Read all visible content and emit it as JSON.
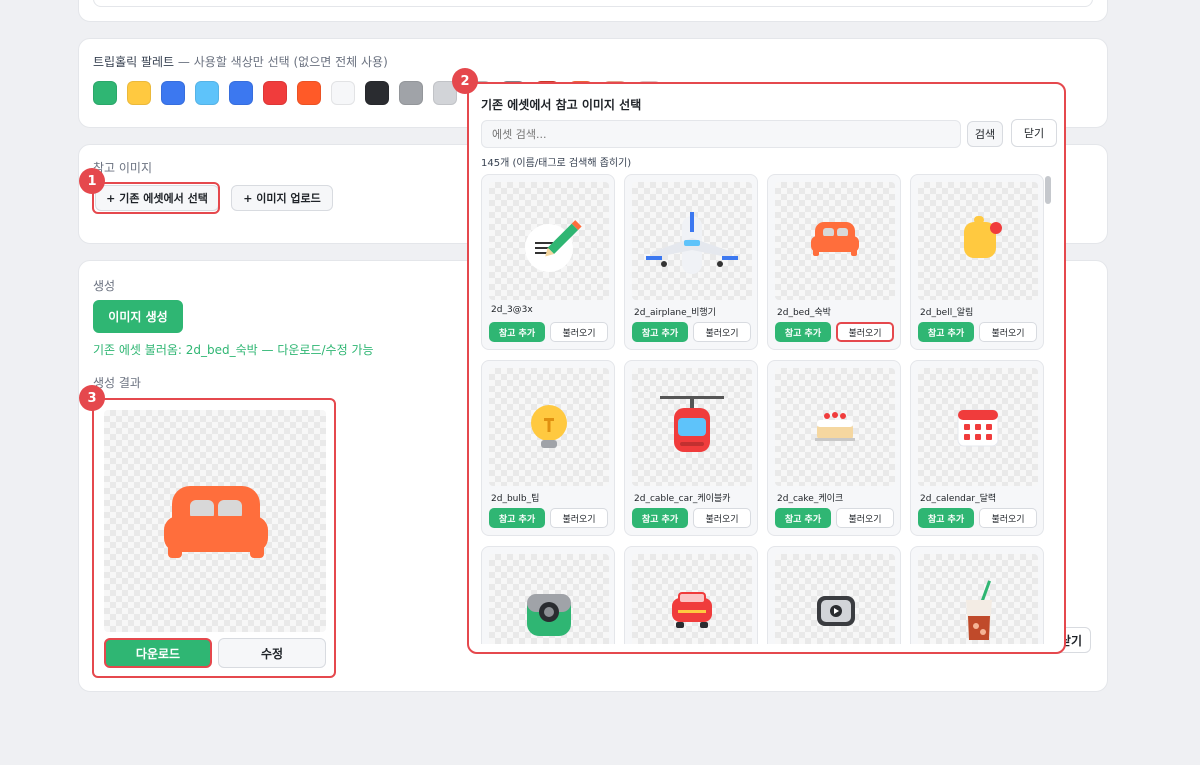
{
  "palette": {
    "title": "트립홀릭 팔레트",
    "hint": " — 사용할 색상만 선택 (없으면 전체 사용)",
    "colors": [
      "#2fb673",
      "#ffc940",
      "#3c78f0",
      "#5ec3fa",
      "#3c78f0",
      "#f03c3c",
      "#ff5a28",
      "#f6f7f9",
      "#2a2c30",
      "#a0a3a8",
      "#d2d4d8",
      "#c8c8c8",
      "#8c8f94",
      "#dc3c2a",
      "#ff6e3c",
      "#f5b496",
      "#f0d2d2"
    ]
  },
  "reference": {
    "title": "참고 이미지",
    "select_existing": "+ 기존 에셋에서 선택",
    "upload": "+ 이미지 업로드"
  },
  "generate": {
    "title": "생성",
    "button": "이미지 생성",
    "status": "기존 에셋 불러옴: 2d_bed_숙박 — 다운로드/수정 가능",
    "result_title": "생성 결과",
    "download": "다운로드",
    "edit": "수정",
    "background_close": "닫기"
  },
  "badges": [
    "1",
    "2",
    "3"
  ],
  "modal": {
    "title": "기존 에셋에서 참고 이미지 선택",
    "search_placeholder": "에셋 검색...",
    "search_button": "검색",
    "close": "닫기",
    "count": "145개 (이름/태그로 검색해 좁히기)",
    "add_label": "참고 추가",
    "load_label": "불러오기",
    "assets": [
      {
        "name": "2d_3@3x",
        "icon": "pencil-note-icon"
      },
      {
        "name": "2d_airplane_비행기",
        "icon": "airplane-icon"
      },
      {
        "name": "2d_bed_숙박",
        "icon": "bed-icon"
      },
      {
        "name": "2d_bell_알림",
        "icon": "bell-icon"
      },
      {
        "name": "2d_bulb_팁",
        "icon": "bulb-icon"
      },
      {
        "name": "2d_cable_car_케이블카",
        "icon": "cable-car-icon"
      },
      {
        "name": "2d_cake_케이크",
        "icon": "cake-icon"
      },
      {
        "name": "2d_calendar_달력",
        "icon": "calendar-icon"
      },
      {
        "name": "",
        "icon": "camera-icon"
      },
      {
        "name": "",
        "icon": "car-icon"
      },
      {
        "name": "",
        "icon": "video-icon"
      },
      {
        "name": "",
        "icon": "drink-icon"
      }
    ]
  }
}
